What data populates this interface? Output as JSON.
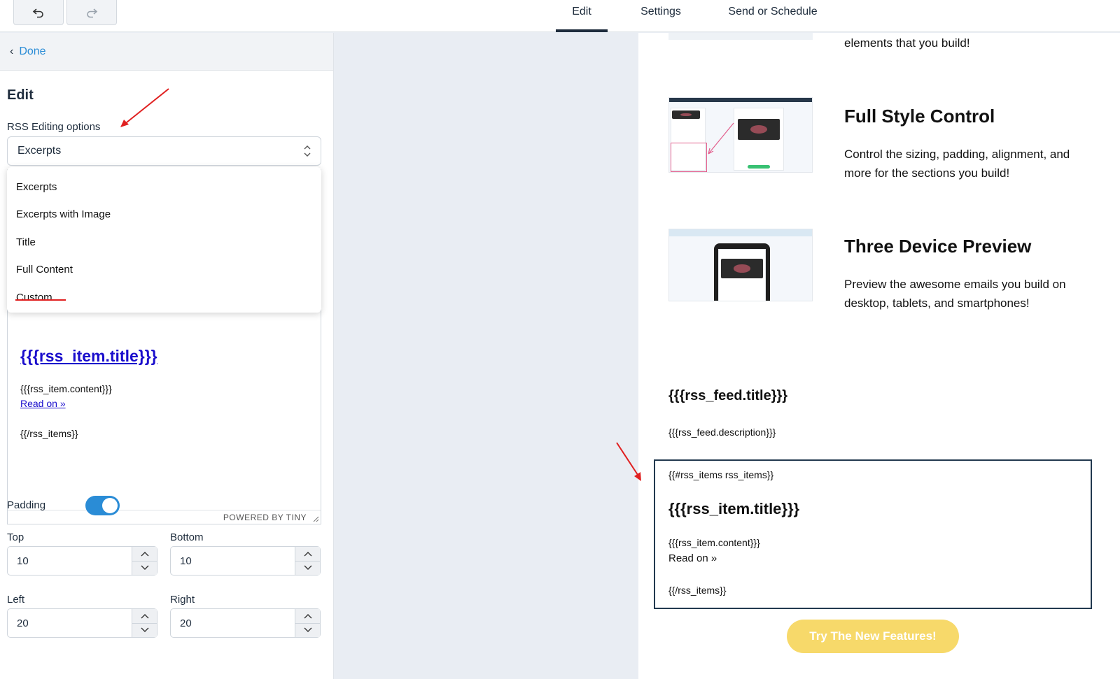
{
  "toolbar": {
    "undo_icon": "undo-icon",
    "redo_icon": "redo-icon",
    "tabs": [
      {
        "label": "Edit",
        "active": true
      },
      {
        "label": "Settings",
        "active": false
      },
      {
        "label": "Send or Schedule",
        "active": false
      }
    ]
  },
  "sidebar": {
    "done_label": "Done",
    "heading": "Edit",
    "rss_label": "RSS Editing options",
    "select_value": "Excerpts",
    "options": [
      "Excerpts",
      "Excerpts with Image",
      "Title",
      "Full Content",
      "Custom"
    ],
    "editor": {
      "title": "{{{rss_item.title}}}",
      "content": "{{{rss_item.content}}}",
      "read_on": "Read on »",
      "end_tag": "{{/rss_items}}",
      "status": "POWERED BY TINY"
    },
    "padding_label": "Padding",
    "padding_enabled": true,
    "fields": {
      "top_label": "Top",
      "top_value": "10",
      "bottom_label": "Bottom",
      "bottom_value": "10",
      "left_label": "Left",
      "left_value": "20",
      "right_label": "Right",
      "right_value": "20"
    }
  },
  "email": {
    "partial_text": "elements that you build!",
    "features": [
      {
        "title": "Full Style Control",
        "text": "Control the sizing, padding, alignment, and more for the sections you build!"
      },
      {
        "title": "Three Device Preview",
        "text": "Preview the awesome emails you build on desktop, tablets, and smartphones!"
      }
    ],
    "feed_title": "{{{rss_feed.title}}}",
    "feed_description": "{{{rss_feed.description}}}",
    "rss_block": {
      "start": "{{#rss_items rss_items}}",
      "item_title": "{{{rss_item.title}}}",
      "item_content": "{{{rss_item.content}}}",
      "read_on": "Read on »",
      "end": "{{/rss_items}}"
    },
    "cta_label": "Try The New Features!"
  },
  "colors": {
    "accent": "#2a8cd6",
    "annotation": "#e02020",
    "cta": "#f7d96a",
    "link": "#1a0dcc"
  }
}
